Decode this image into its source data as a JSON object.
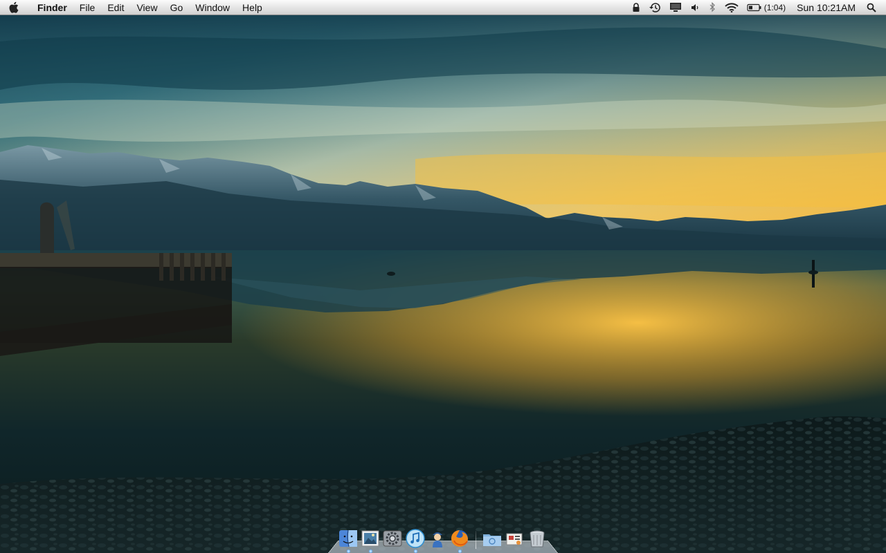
{
  "menubar": {
    "apple_icon": "apple-logo-icon",
    "app_name": "Finder",
    "menus": [
      "File",
      "Edit",
      "View",
      "Go",
      "Window",
      "Help"
    ],
    "status_icons": [
      "lock-icon",
      "time-machine-icon",
      "display-mirroring-icon",
      "volume-icon",
      "bluetooth-icon",
      "wifi-icon",
      "battery-icon"
    ],
    "battery_time": "(1:04)",
    "clock": "Sun 10:21AM",
    "spotlight_icon": "spotlight-search-icon"
  },
  "dock": {
    "apps": [
      {
        "name": "finder-icon",
        "running": true
      },
      {
        "name": "preview-icon",
        "running": true
      },
      {
        "name": "system-preferences-icon",
        "running": false
      },
      {
        "name": "itunes-icon",
        "running": true
      },
      {
        "name": "app-character-icon",
        "running": false
      },
      {
        "name": "firefox-icon",
        "running": true
      }
    ],
    "stacks": [
      "downloads-folder-icon",
      "documents-stack-icon",
      "trash-icon"
    ]
  },
  "colors": {
    "sky_top": "#1c4a5a",
    "sunset": "#f2b43c",
    "water": "#0f2a2e"
  }
}
